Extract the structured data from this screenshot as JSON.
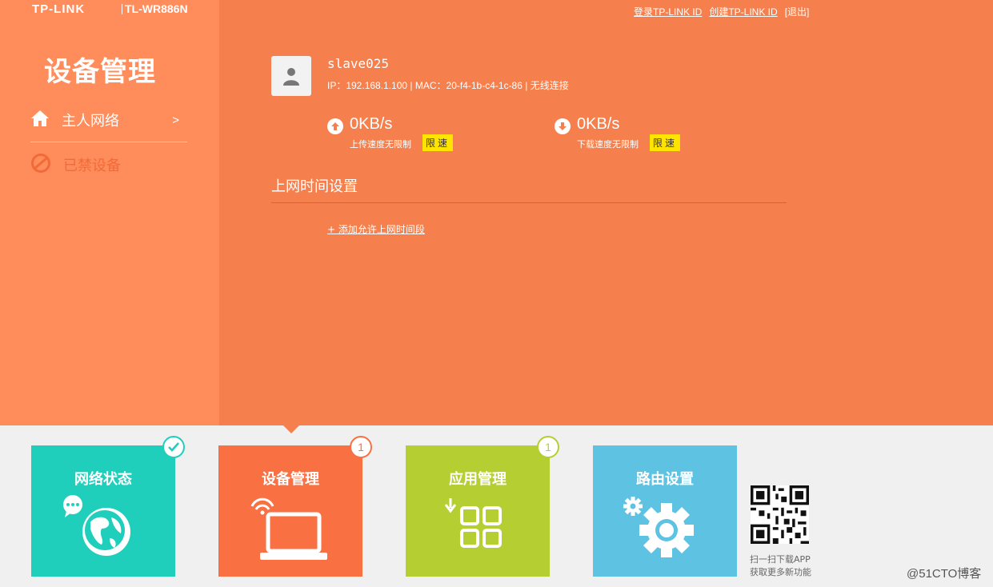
{
  "header": {
    "brand": "TP-LINK",
    "model": "TL-WR886N",
    "links": [
      "登录TP-LINK ID",
      "创建TP-LINK ID",
      "[退出]"
    ]
  },
  "sidebar": {
    "title": "设备管理",
    "items": [
      {
        "label": "主人网络",
        "arrow": ">",
        "icon": "home-icon"
      },
      {
        "label": "已禁设备",
        "icon": "blocked-icon"
      }
    ]
  },
  "device": {
    "name": "slave025",
    "info": "IP：192.168.1.100 | MAC：20-f4-1b-c4-1c-86 | 无线连接",
    "upload": {
      "value": "0KB/s",
      "label": "上传速度无限制",
      "button": "限速"
    },
    "download": {
      "value": "0KB/s",
      "label": "下载速度无限制",
      "button": "限速"
    }
  },
  "schedule": {
    "title": "上网时间设置",
    "add_link": "+ 添加允许上网时间段"
  },
  "tiles": [
    {
      "label": "网络状态",
      "badge": "✓",
      "color": "#20cfbb",
      "icon": "globe-icon"
    },
    {
      "label": "设备管理",
      "badge": "1",
      "color": "#f97042",
      "icon": "laptop-icon"
    },
    {
      "label": "应用管理",
      "badge": "1",
      "color": "#b5ce32",
      "icon": "apps-icon"
    },
    {
      "label": "路由设置",
      "badge": "",
      "color": "#5ec3e3",
      "icon": "gear-icon"
    }
  ],
  "qr": {
    "line1": "扫一扫下载APP",
    "line2": "获取更多新功能"
  },
  "watermark": "@51CTO博客",
  "colors": {
    "main_bg": "#f5804d",
    "sidebar_bg": "#ff8c5b",
    "speed_button": "#ffe400"
  }
}
